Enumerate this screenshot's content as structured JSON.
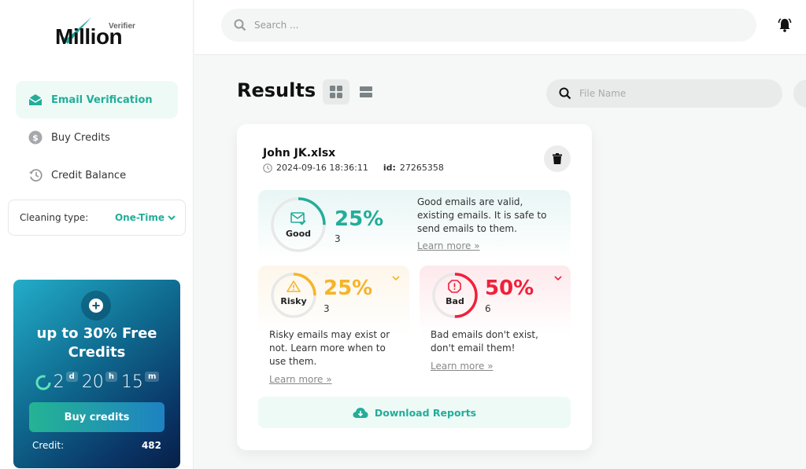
{
  "brand": {
    "name": "Million",
    "sub": "Verifier",
    "accent": "#22ad9a"
  },
  "sidebar": {
    "items": [
      {
        "label": "Email Verification",
        "icon": "envelope-open-icon",
        "active": true
      },
      {
        "label": "Buy Credits",
        "icon": "dollar-circle-icon",
        "active": false
      },
      {
        "label": "Credit Balance",
        "icon": "history-icon",
        "active": false
      }
    ],
    "cleaning": {
      "label": "Cleaning type:",
      "value": "One-Time"
    },
    "promo": {
      "title": "up to 30% Free Credits",
      "countdown": {
        "days": "2",
        "days_unit": "d",
        "hours": "20",
        "hours_unit": "h",
        "minutes": "15",
        "minutes_unit": "m"
      },
      "button": "Buy credits",
      "credit_label": "Credit:",
      "credit_value": "482"
    }
  },
  "topbar": {
    "search_placeholder": "Search ..."
  },
  "results": {
    "title": "Results",
    "file_search_placeholder": "File Name",
    "card": {
      "file_name": "John JK.xlsx",
      "timestamp": "2024-09-16 18:36:11",
      "id_label": "id:",
      "id_value": "27265358",
      "good": {
        "label": "Good",
        "percent": "25%",
        "fraction": 0.25,
        "count": "3",
        "desc": "Good emails are valid, existing emails. It is safe to send emails to them.",
        "learn": "Learn more »",
        "color": "#22ad9a"
      },
      "risky": {
        "label": "Risky",
        "percent": "25%",
        "fraction": 0.25,
        "count": "3",
        "desc": "Risky emails may exist or not. Learn more when to use them.",
        "learn": "Learn more »",
        "color": "#f5b42a"
      },
      "bad": {
        "label": "Bad",
        "percent": "50%",
        "fraction": 0.5,
        "count": "6",
        "desc": "Bad emails don't exist, don't email them!",
        "learn": "Learn more »",
        "color": "#f0203a"
      },
      "download": "Download Reports"
    }
  }
}
